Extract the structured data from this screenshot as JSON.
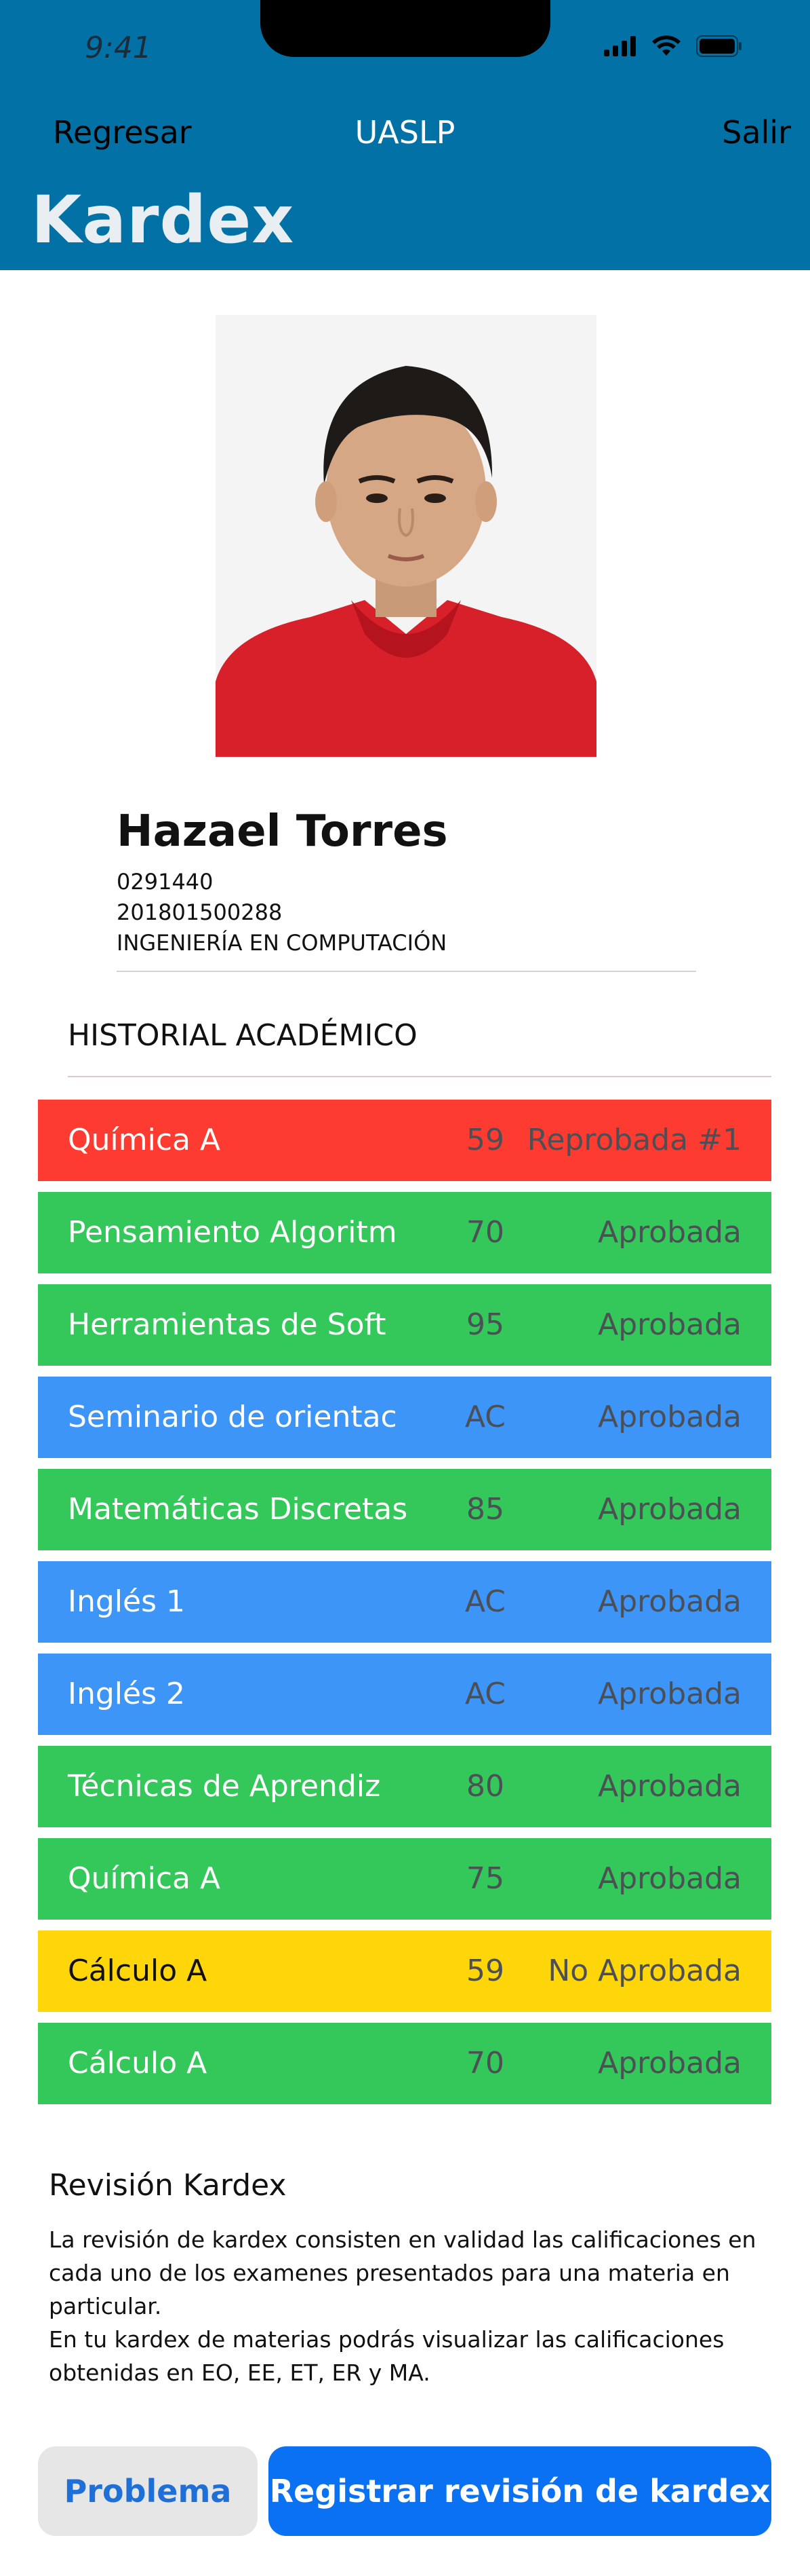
{
  "status_bar": {
    "time": "9:41",
    "icons": [
      "signal-icon",
      "wifi-icon",
      "battery-icon"
    ]
  },
  "nav": {
    "back_label": "Regresar",
    "title": "UASLP",
    "exit_label": "Salir"
  },
  "page": {
    "title": "Kardex"
  },
  "colors": {
    "header": "#0271a6",
    "failed": "#fe3b30",
    "passed": "#34c759",
    "accredited": "#3e95f8",
    "not_passed": "#fed60a",
    "primary_button": "#0a72f2"
  },
  "student": {
    "name": "Hazael Torres",
    "key": "0291440",
    "account": "201801500288",
    "career": "INGENIERÍA EN COMPUTACIÓN"
  },
  "history": {
    "title": "HISTORIAL ACADÉMICO",
    "courses": [
      {
        "name": "Química A",
        "grade": "59",
        "status": "Reprobada #1",
        "color": "#fe3b30"
      },
      {
        "name": "Pensamiento Algoritm",
        "grade": "70",
        "status": "Aprobada",
        "color": "#34c759"
      },
      {
        "name": "Herramientas de Soft",
        "grade": "95",
        "status": "Aprobada",
        "color": "#34c759"
      },
      {
        "name": "Seminario de orientac",
        "grade": "AC",
        "status": "Aprobada",
        "color": "#3e95f8"
      },
      {
        "name": "Matemáticas Discretas",
        "grade": "85",
        "status": "Aprobada",
        "color": "#34c759"
      },
      {
        "name": "Inglés 1",
        "grade": "AC",
        "status": "Aprobada",
        "color": "#3e95f8"
      },
      {
        "name": "Inglés 2",
        "grade": "AC",
        "status": "Aprobada",
        "color": "#3e95f8"
      },
      {
        "name": "Técnicas de Aprendiz",
        "grade": "80",
        "status": "Aprobada",
        "color": "#34c759"
      },
      {
        "name": "Química A",
        "grade": "75",
        "status": "Aprobada",
        "color": "#34c759"
      },
      {
        "name": "Cálculo A",
        "grade": "59",
        "status": "No Aprobada",
        "color": "#fed60a"
      },
      {
        "name": "Cálculo A",
        "grade": "70",
        "status": "Aprobada",
        "color": "#34c759"
      }
    ]
  },
  "review": {
    "title": "Revisión Kardex",
    "paragraph1": "La revisión de kardex consisten en validad las calificaciones en cada uno de los examenes presentados para una materia en particular.",
    "paragraph2": "En tu kardex de materias podrás visualizar las calificaciones obtenidas en EO, EE, ET, ER y MA."
  },
  "buttons": {
    "problem_label": "Problema",
    "register_label": "Registrar revisión de kardex"
  }
}
